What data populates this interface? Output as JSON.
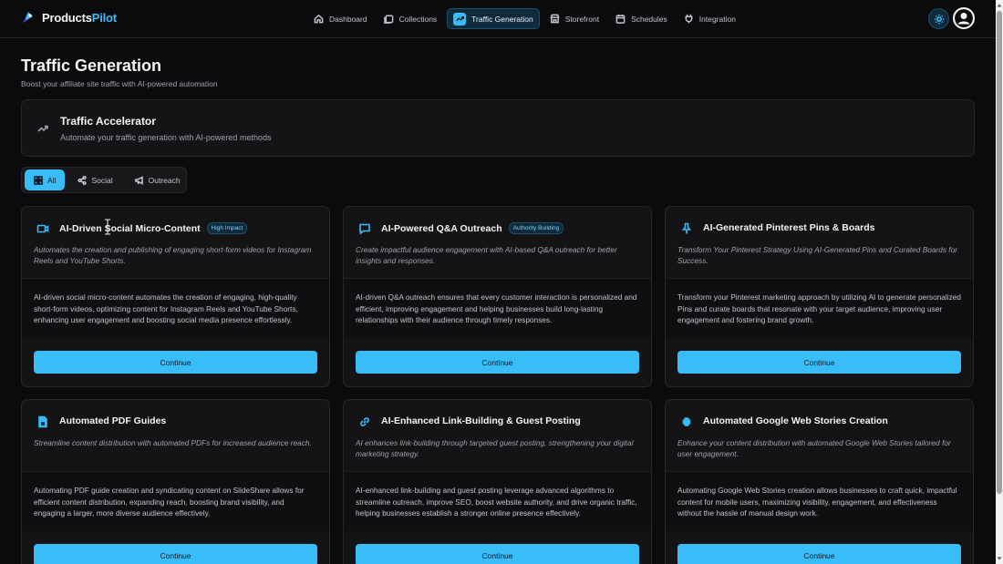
{
  "brand": {
    "name_part1": "Products",
    "name_part2": "Pilot"
  },
  "nav": [
    {
      "label": "Dashboard",
      "icon": "home-icon"
    },
    {
      "label": "Collections",
      "icon": "collections-icon"
    },
    {
      "label": "Traffic Generation",
      "icon": "trending-up-icon",
      "active": true
    },
    {
      "label": "Storefront",
      "icon": "store-icon"
    },
    {
      "label": "Schedules",
      "icon": "calendar-icon"
    },
    {
      "label": "Integration",
      "icon": "plug-icon"
    }
  ],
  "page": {
    "title": "Traffic Generation",
    "subtitle": "Boost your affiliate site traffic with AI-powered automation"
  },
  "banner": {
    "title": "Traffic Accelerator",
    "subtitle": "Automate your traffic generation with AI-powered methods"
  },
  "filters": [
    {
      "label": "All",
      "active": true
    },
    {
      "label": "Social"
    },
    {
      "label": "Outreach"
    }
  ],
  "cards": [
    {
      "title": "AI-Driven Social Micro-Content",
      "badge": "High Impact",
      "icon": "video-icon",
      "tagline": "Automates the creation and publishing of engaging short-form videos for Instagram Reels and YouTube Shorts.",
      "description": "AI-driven social micro-content automates the creation of engaging, high-quality short-form videos, optimizing content for Instagram Reels and YouTube Shorts, enhancing user engagement and boosting social media presence effortlessly.",
      "button": "Continue"
    },
    {
      "title": "AI-Powered Q&A Outreach",
      "badge": "Authority Building",
      "icon": "chat-icon",
      "tagline": "Create impactful audience engagement with AI-based Q&A outreach for better insights and responses.",
      "description": "AI-driven Q&A outreach ensures that every customer interaction is personalized and efficient, improving engagement and helping businesses build long-lasting relationships with their audience through timely responses.",
      "button": "Continue"
    },
    {
      "title": "AI-Generated Pinterest Pins & Boards",
      "badge": "",
      "icon": "pin-icon",
      "tagline": "Transform Your Pinterest Strategy Using AI-Generated Pins and Curated Boards for Success.",
      "description": "Transform your Pinterest marketing approach by utilizing AI to generate personalized Pins and curate boards that resonate with your target audience, improving user engagement and fostering brand growth.",
      "button": "Continue"
    },
    {
      "title": "Automated PDF Guides",
      "badge": "",
      "icon": "pdf-icon",
      "tagline": "Streamline content distribution with automated PDFs for increased audience reach.",
      "description": "Automating PDF guide creation and syndicating content on SlideShare allows for efficient content distribution, expanding reach, boosting brand visibility, and engaging a larger, more diverse audience effectively.",
      "button": "Continue"
    },
    {
      "title": "AI-Enhanced Link-Building & Guest Posting",
      "badge": "",
      "icon": "link-icon",
      "tagline": "AI enhances link-building through targeted guest posting, strengthening your digital marketing strategy.",
      "description": "AI-enhanced link-building and guest posting leverage advanced algorithms to streamline outreach, improve SEO, boost website authority, and drive organic traffic, helping businesses establish a stronger online presence effectively.",
      "button": "Continue"
    },
    {
      "title": "Automated Google Web Stories Creation",
      "badge": "",
      "icon": "web-stories-icon",
      "tagline": "Enhance your content distribution with automated Google Web Stories tailored for user engagement.",
      "description": "Automating Google Web Stories creation allows businesses to craft quick, impactful content for mobile users, maximizing visibility, engagement, and effectiveness without the hassle of manual design work.",
      "button": "Continue"
    }
  ],
  "colors": {
    "accent": "#38bdf8",
    "background": "#0b0b0d",
    "card": "#141416"
  }
}
